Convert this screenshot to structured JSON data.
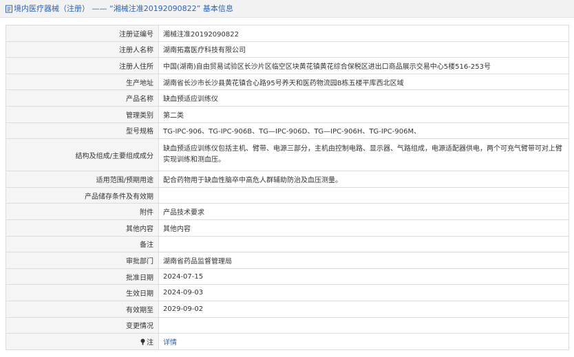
{
  "header": {
    "icon": "document-icon",
    "title": "境内医疗器械（注册） —— “湘械注准20192090822” 基本信息"
  },
  "rows": [
    {
      "label": "注册证编号",
      "value": "湘械注准20192090822"
    },
    {
      "label": "注册人名称",
      "value": "湖南拓嘉医疗科技有限公司"
    },
    {
      "label": "注册人住所",
      "value": "中国(湖南)自由贸易试验区长沙片区临空区块黄花镇黄花综合保税区进出口商品展示交易中心5楼516-253号"
    },
    {
      "label": "生产地址",
      "value": "湖南省长沙市长沙县黄花镇合心路95号养天和医药物流园B栋五楼平库西北区域"
    },
    {
      "label": "产品名称",
      "value": "缺血预适应训练仪"
    },
    {
      "label": "管理类别",
      "value": "第二类"
    },
    {
      "label": "型号规格",
      "value": "TG-IPC-906、TG-IPC-906B、TG—IPC-906D、TG—IPC-906H、TG-IPC-906M、"
    },
    {
      "label": "结构及组成/主要组成成分",
      "value": "缺血预适应训练仪包括主机、臂带、电源三部分，主机由控制电路、显示器、气路组成，电源适配器供电，两个可充气臂带可对上臂实现训练和测血压。"
    },
    {
      "label": "适用范围/预期用途",
      "value": "配合药物用于缺血性脑卒中高危人群辅助防治及血压测量。"
    },
    {
      "label": "产品储存条件及有效期",
      "value": ""
    },
    {
      "label": "附件",
      "value": "产品技术要求"
    },
    {
      "label": "其他内容",
      "value": "其他内容"
    },
    {
      "label": "备注",
      "value": ""
    },
    {
      "label": "审批部门",
      "value": "湖南省药品监督管理局"
    },
    {
      "label": "批准日期",
      "value": "2024-07-15"
    },
    {
      "label": "生效日期",
      "value": "2024-09-03"
    },
    {
      "label": "有效期至",
      "value": "2029-09-02"
    },
    {
      "label": "变更情况",
      "value": ""
    },
    {
      "label": "注",
      "value": "详情",
      "icon": "note-icon"
    }
  ],
  "colors": {
    "link": "#2d63b5",
    "label_bg": "#f5f5f5",
    "border": "#dcdcdc"
  }
}
